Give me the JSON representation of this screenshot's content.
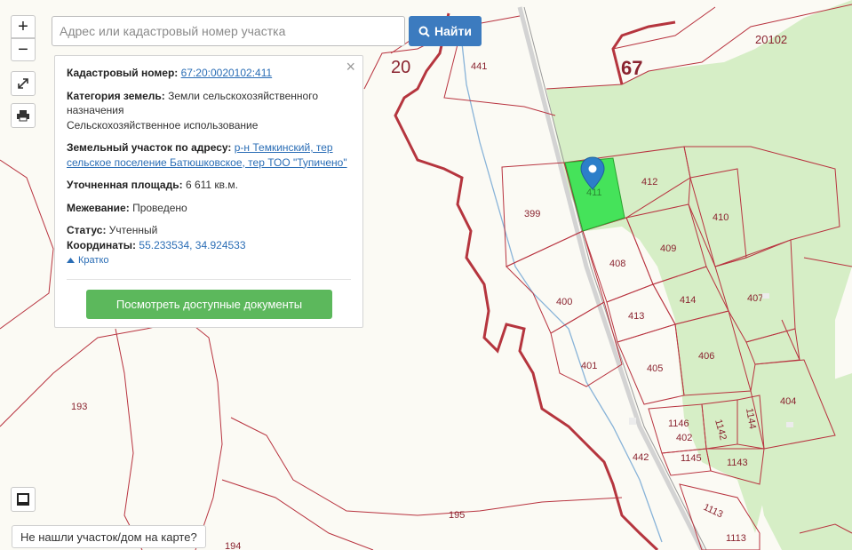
{
  "search": {
    "placeholder": "Адрес или кадастровый номер участка",
    "button": "Найти"
  },
  "zoom": {
    "in": "+",
    "out": "−"
  },
  "tools": [
    "expand-icon",
    "print-icon",
    "layers-icon"
  ],
  "card": {
    "cadastral_label": "Кадастровый номер:",
    "cadastral_value": "67:20:0020102:411",
    "category_label": "Категория земель:",
    "category_value_1": "Земли сельскохозяйственного назначения",
    "category_value_2": "Сельскохозяйственное использование",
    "address_label": "Земельный участок по адресу:",
    "address_value": "р-н Темкинский, тер сельское поселение Батюшковское, тер ТОО \"Тупичено\"",
    "area_label": "Уточненная площадь:",
    "area_value": "6 611 кв.м.",
    "survey_label": "Межевание:",
    "survey_value": "Проведено",
    "status_label": "Статус:",
    "status_value": "Учтенный",
    "coords_label": "Координаты:",
    "coords_value": "55.233534, 34.924533",
    "short_link": "Кратко",
    "docs_button": "Посмотреть доступные документы",
    "close": "×"
  },
  "notfound": "Не нашли участок/дом на карте?",
  "map": {
    "block_labels": [
      "20",
      "67",
      "20102"
    ],
    "parcel_labels": [
      "441",
      "412",
      "411",
      "410",
      "399",
      "409",
      "408",
      "407",
      "414",
      "413",
      "400",
      "406",
      "405",
      "401",
      "404",
      "1146",
      "1142",
      "1144",
      "402",
      "1145",
      "1143",
      "442",
      "193",
      "195",
      "194",
      "1113",
      "1113"
    ],
    "selected_parcel": "411",
    "colors": {
      "boundary": "#b8333f",
      "selected": "#45e35a",
      "forest": "#d5edc6",
      "marker": "#2c7fc9"
    }
  }
}
